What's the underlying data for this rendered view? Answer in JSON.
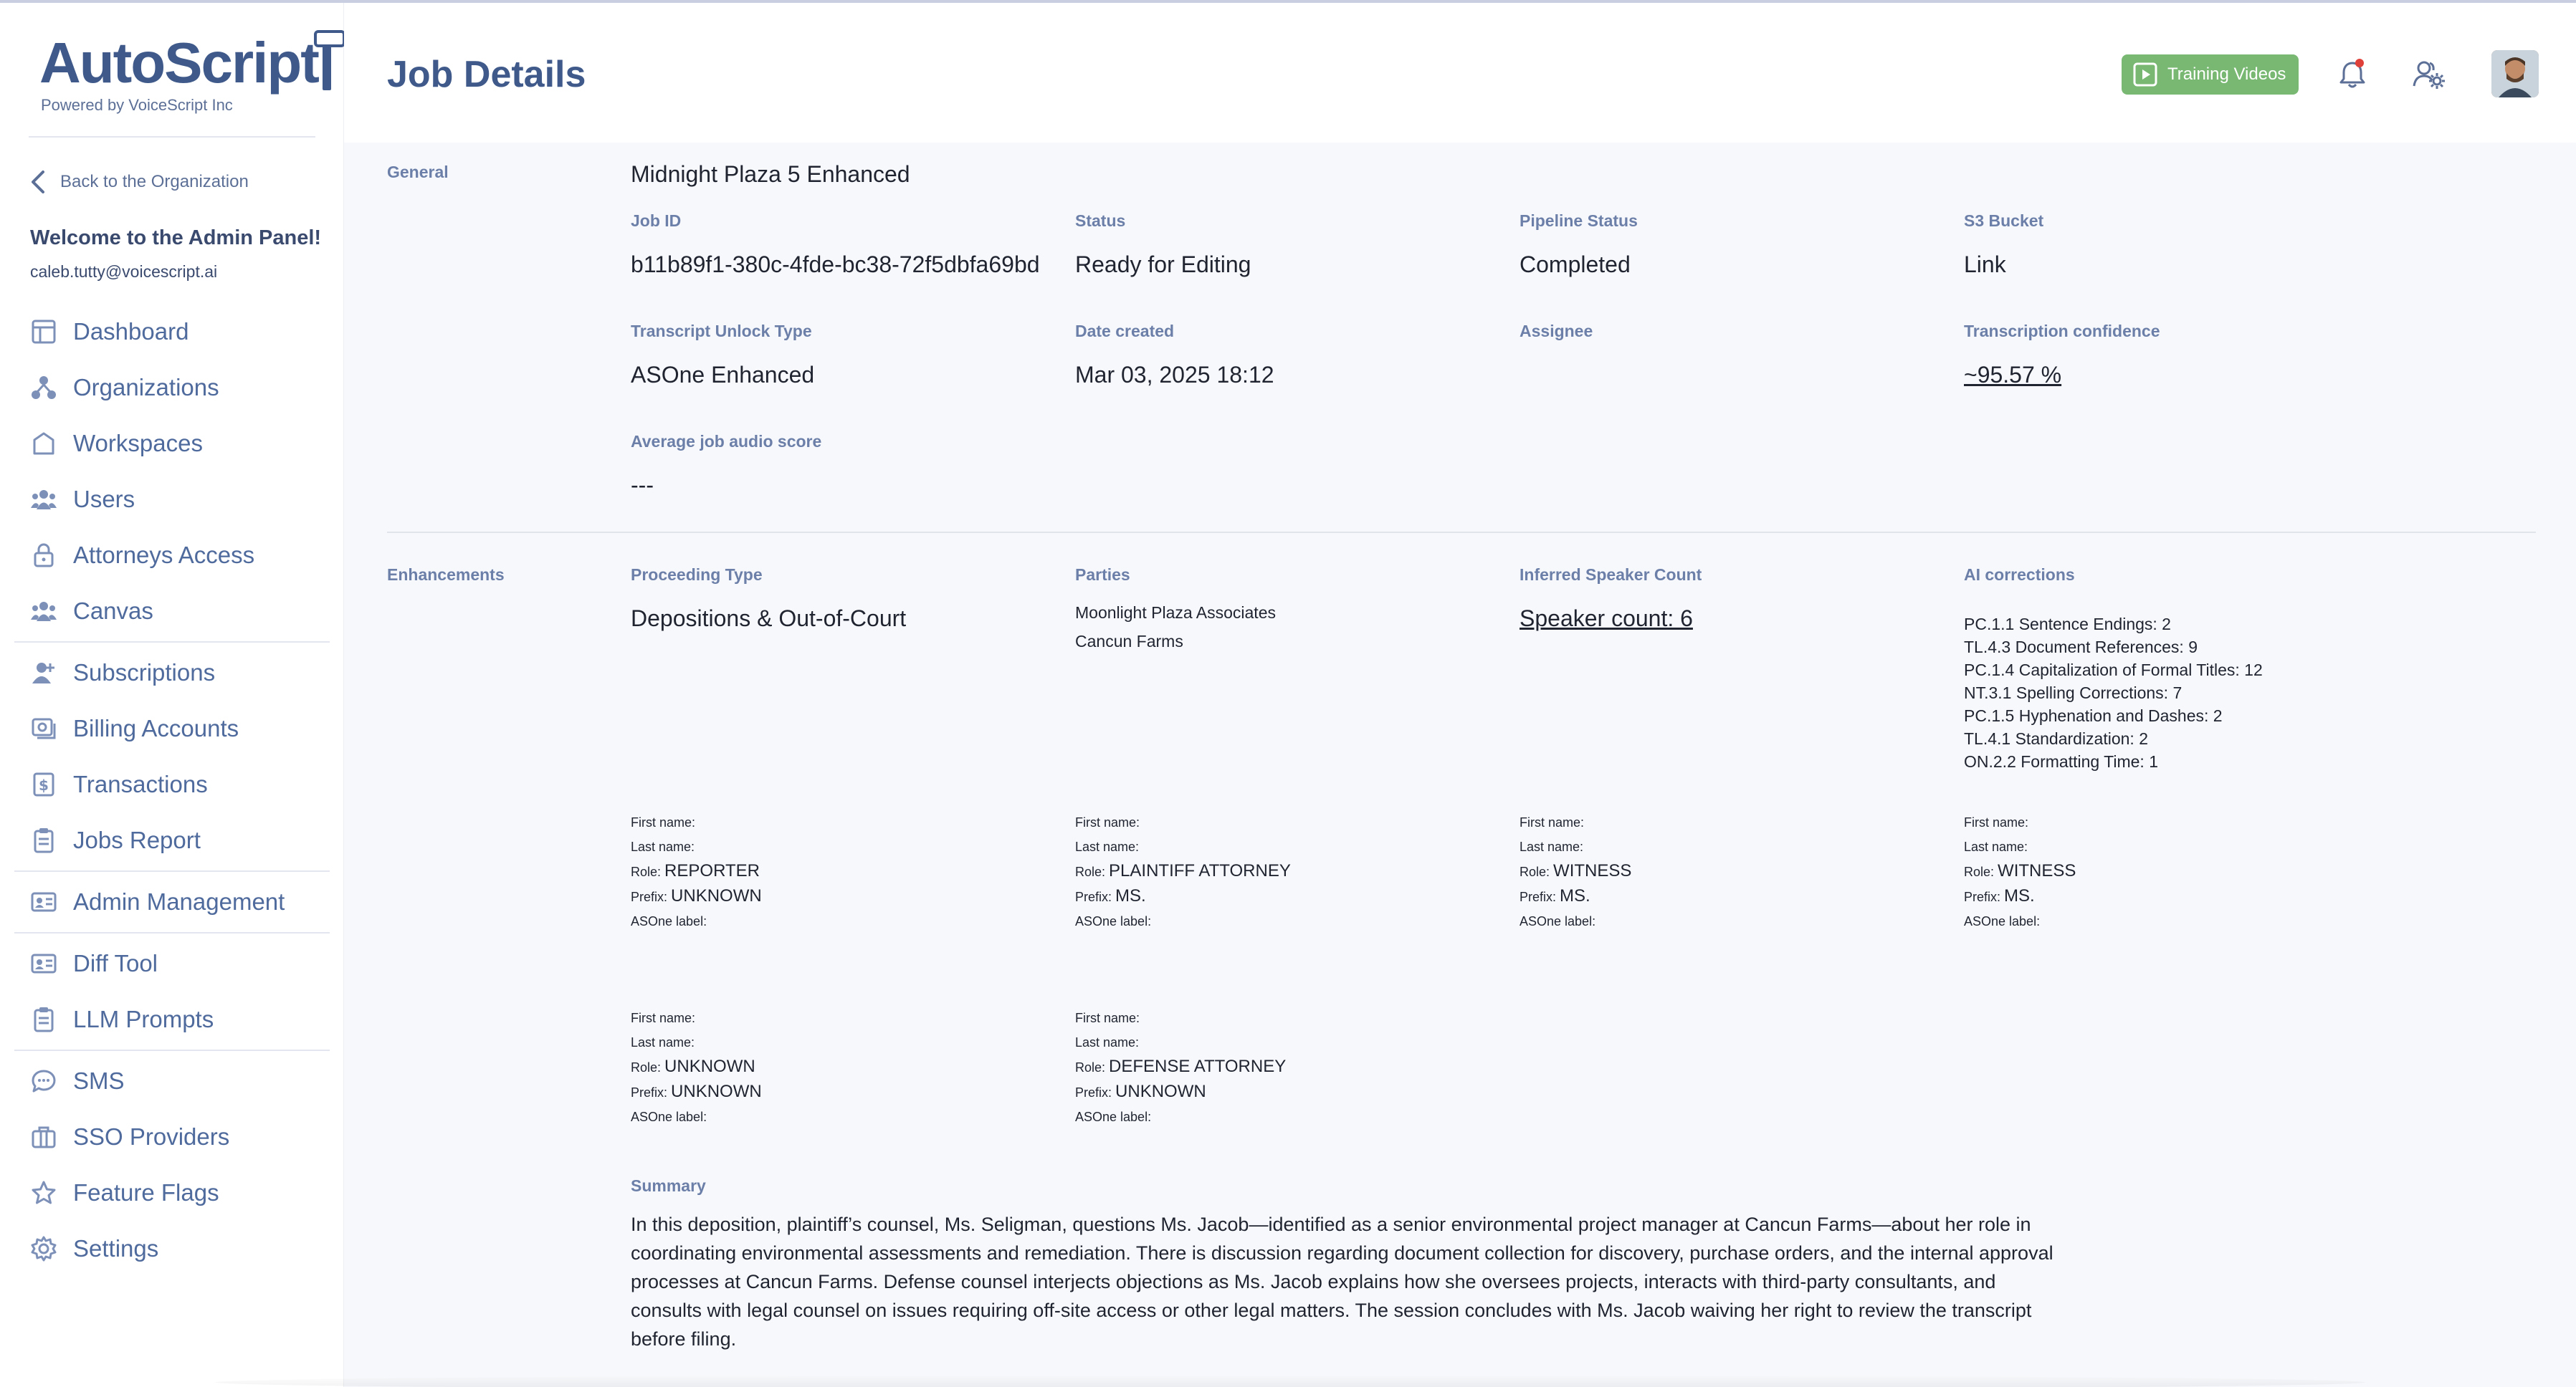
{
  "sidebar": {
    "logo_title": "AutoScript",
    "logo_sub": "Powered by VoiceScript Inc",
    "back_label": "Back to the Organization",
    "welcome": "Welcome to the Admin Panel!",
    "email": "caleb.tutty@voicescript.ai",
    "nav": {
      "dashboard": "Dashboard",
      "organizations": "Organizations",
      "workspaces": "Workspaces",
      "users": "Users",
      "attorneys": "Attorneys Access",
      "canvas": "Canvas",
      "subscriptions": "Subscriptions",
      "billing": "Billing Accounts",
      "transactions": "Transactions",
      "jobs_report": "Jobs Report",
      "admin_management": "Admin Management",
      "diff_tool": "Diff Tool",
      "llm_prompts": "LLM Prompts",
      "sms": "SMS",
      "sso": "SSO Providers",
      "feature_flags": "Feature Flags",
      "settings": "Settings"
    }
  },
  "header": {
    "title": "Job Details",
    "training_label": "Training Videos",
    "accent": "#78b873"
  },
  "general": {
    "section_label": "General",
    "job_name": "Midnight Plaza 5 Enhanced",
    "job_id_label": "Job ID",
    "job_id": "b11b89f1-380c-4fde-bc38-72f5dbfa69bd",
    "status_label": "Status",
    "status": "Ready for Editing",
    "pipeline_label": "Pipeline Status",
    "pipeline": "Completed",
    "s3_label": "S3 Bucket",
    "s3": "Link",
    "unlock_label": "Transcript Unlock Type",
    "unlock": "ASOne Enhanced",
    "date_label": "Date created",
    "date": "Mar 03, 2025 18:12",
    "assignee_label": "Assignee",
    "confidence_label": "Transcription confidence",
    "confidence": "~95.57 %",
    "audio_score_label": "Average job audio score",
    "audio_score": "---"
  },
  "enhancements": {
    "section_label": "Enhancements",
    "proceeding_label": "Proceeding Type",
    "proceeding": "Depositions & Out-of-Court",
    "parties_label": "Parties",
    "parties": [
      "Moonlight Plaza Associates",
      "Cancun Farms"
    ],
    "speaker_count_label": "Inferred Speaker Count",
    "speaker_count": "Speaker count: 6",
    "ai_label": "AI corrections",
    "ai_corrections": [
      "PC.1.1 Sentence Endings: 2",
      "TL.4.3 Document References: 9",
      "PC.1.4 Capitalization of Formal Titles: 12",
      "NT.3.1 Spelling Corrections: 7",
      "PC.1.5 Hyphenation and Dashes: 2",
      "TL.4.1 Standardization: 2",
      "ON.2.2 Formatting Time: 1"
    ],
    "speaker_labels": {
      "first": "First name:",
      "last": "Last name:",
      "role": "Role:",
      "prefix": "Prefix:",
      "asone": "ASOne label:"
    },
    "speakers": [
      {
        "role": "REPORTER",
        "prefix": "UNKNOWN"
      },
      {
        "role": "PLAINTIFF ATTORNEY",
        "prefix": "MS."
      },
      {
        "role": "WITNESS",
        "prefix": "MS."
      },
      {
        "role": "WITNESS",
        "prefix": "MS."
      },
      {
        "role": "UNKNOWN",
        "prefix": "UNKNOWN"
      },
      {
        "role": "DEFENSE ATTORNEY",
        "prefix": "UNKNOWN"
      }
    ],
    "summary_label": "Summary",
    "summary": "In this deposition, plaintiff’s counsel, Ms. Seligman, questions Ms. Jacob—identified as a senior environmental project manager at Cancun Farms—about her role in coordinating environmental assessments and remediation. There is discussion regarding document collection for discovery, purchase orders, and the internal approval processes at Cancun Farms. Defense counsel interjects objections as Ms. Jacob explains how she oversees projects, interacts with third-party consultants, and consults with legal counsel on issues requiring off-site access or other legal matters. The session concludes with Ms. Jacob waiving her right to review the transcript before filing."
  }
}
